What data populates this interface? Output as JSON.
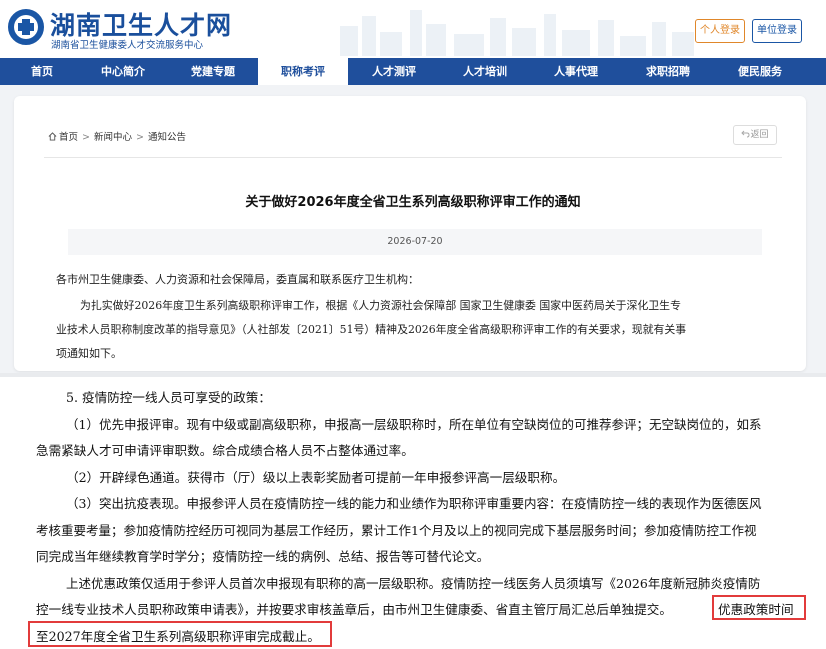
{
  "header": {
    "site_title": "湖南卫生人才网",
    "site_subtitle": "湖南省卫生健康委人才交流服务中心",
    "personal_login": "个人登录",
    "unit_login": "单位登录"
  },
  "nav": {
    "items": [
      {
        "label": "首页"
      },
      {
        "label": "中心简介"
      },
      {
        "label": "党建专题"
      },
      {
        "label": "职称考评"
      },
      {
        "label": "人才测评"
      },
      {
        "label": "人才培训"
      },
      {
        "label": "人事代理"
      },
      {
        "label": "求职招聘"
      },
      {
        "label": "便民服务"
      }
    ],
    "active": "职称考评"
  },
  "breadcrumb": {
    "home": "首页",
    "news": "新闻中心",
    "notice": "通知公告",
    "separator": ">"
  },
  "back_label": "返回",
  "article": {
    "title": "关于做好2026年度全省卫生系列高级职称评审工作的通知",
    "date": "2026-07-20",
    "lines": [
      "各市州卫生健康委、人力资源和社会保障局，委直属和联系医疗卫生机构：",
      "为扎实做好2026年度卫生系列高级职称评审工作，根据《人力资源社会保障部 国家卫生健康委 国家中医药局关于深化卫生专",
      "业技术人员职称制度改革的指导意见》（人社部发〔2021〕51号）精神及2026年度全省高级职称评审工作的有关要求，现就有关事",
      "项通知如下。"
    ]
  },
  "document": {
    "lines": [
      "5. 疫情防控一线人员可享受的政策：",
      "（1）优先申报评审。现有中级或副高级职称，申报高一层级职称时，所在单位有空缺岗位的可推荐参评；无空缺岗位的，如系",
      "急需紧缺人才可申请评审职数。综合成绩合格人员不占整体通过率。",
      "（2）开辟绿色通道。获得市（厅）级以上表彰奖励者可提前一年申报参评高一层级职称。",
      "（3）突出抗疫表现。申报参评人员在疫情防控一线的能力和业绩作为职称评审重要内容：在疫情防控一线的表现作为医德医风",
      "考核重要考量；参加疫情防控经历可视同为基层工作经历，累计工作1个月及以上的视同完成下基层服务时间；参加疫情防控工作视",
      "同完成当年继续教育学时学分；疫情防控一线的病例、总结、报告等可替代论文。",
      "上述优惠政策仅适用于参评人员首次申报现有职称的高一层级职称。疫情防控一线医务人员须填写《2026年度新冠肺炎疫情防",
      "控一线专业技术人员职称政策申请表》，并按要求审核盖章后，由市州卫生健康委、省直主管厅局汇总后单独提交。",
      "优惠政策时间",
      "至2027年度全省卫生系列高级职称评审完成截止。"
    ]
  },
  "colors": {
    "brand_blue": "#1f4f9c",
    "orange": "#e0872a",
    "highlight_red": "#e23b3b"
  }
}
